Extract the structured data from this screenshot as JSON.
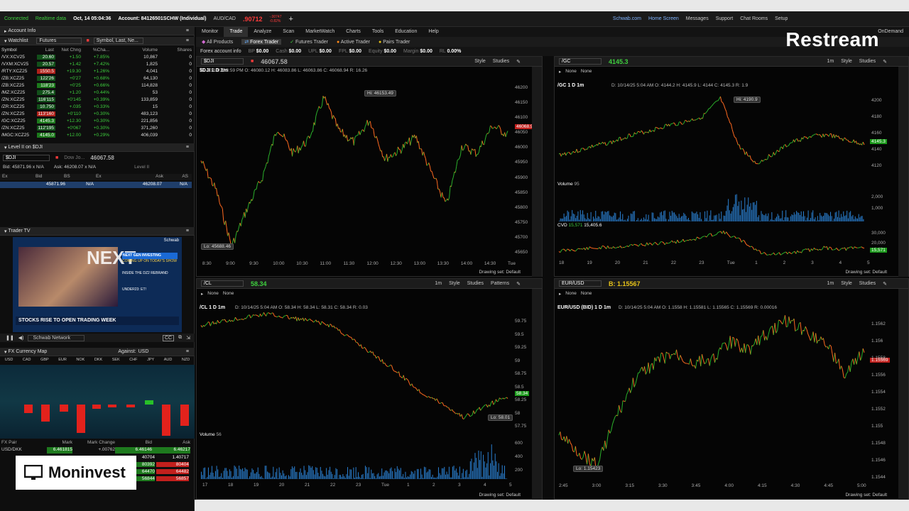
{
  "topbar": {
    "connected": "Connected",
    "realtime": "Realtime data",
    "datetime": "Oct, 14  05:04:36",
    "account": "Account: 84126501SCHW (Individual)",
    "pair": "AUD/CAD",
    "pair_value": ".90712",
    "pair_change": "-.00747",
    "pair_pct": "-0.82%",
    "schwab": "Schwab.com",
    "home": "Home Screen",
    "messages": "Messages",
    "support": "Support",
    "chat": "Chat Rooms",
    "setup": "Setup"
  },
  "menu": [
    "Monitor",
    "Trade",
    "Analyze",
    "Scan",
    "MarketWatch",
    "Charts",
    "Tools",
    "Education",
    "Help"
  ],
  "ondemand": "OnDemand",
  "subtabs": [
    "All Products",
    "Forex Trader",
    "Futures Trader",
    "Active Trader",
    "Pairs Trader"
  ],
  "acct": {
    "label": "Forex account info",
    "bp": "BP",
    "bp_v": "$0.00",
    "cash": "Cash",
    "cash_v": "$0.00",
    "upl": "UPL",
    "upl_v": "$0.00",
    "fpl": "FPL",
    "fpl_v": "$0.00",
    "equity": "Equity",
    "equity_v": "$0.00",
    "margin": "Margin",
    "margin_v": "$0.00",
    "rl": "RL",
    "rl_v": "0.00%"
  },
  "left": {
    "account_info": "Account Info",
    "watchlist": "Watchlist",
    "watchlist_type": "Futures",
    "symbol_search": "Symbol, Last, Ne...",
    "cols": [
      "Symbol",
      "Last",
      "Net Chng",
      "%Cha...",
      "Volume",
      "Shares"
    ],
    "rows": [
      {
        "sym": "/VX:XCV25",
        "last": "20.60",
        "net": "+1.50",
        "pct": "+7.85%",
        "vol": "10,867",
        "sh": "0",
        "up": true
      },
      {
        "sym": "/VXM:XCV25",
        "last": "20.57",
        "net": "+1.42",
        "pct": "+7.42%",
        "vol": "1,825",
        "sh": "0",
        "up": true
      },
      {
        "sym": "/RTY:XCZ25",
        "last": "1550.5",
        "net": "+19.30",
        "pct": "+1.26%",
        "vol": "4,041",
        "sh": "0",
        "up": true
      },
      {
        "sym": "/ZB:XCZ25",
        "last": "122'26",
        "net": "+0'27",
        "pct": "+0.68%",
        "vol": "64,130",
        "sh": "0",
        "up": true
      },
      {
        "sym": "/ZB:XCZ25",
        "last": "118'23",
        "net": "+0'25",
        "pct": "+0.66%",
        "vol": "114,828",
        "sh": "0",
        "up": true
      },
      {
        "sym": "/MZ:XCZ25",
        "last": "275.4",
        "net": "+1.20",
        "pct": "+0.44%",
        "vol": "53",
        "sh": "0",
        "up": true
      },
      {
        "sym": "/ZN:XCZ25",
        "last": "116'115",
        "net": "+0'145",
        "pct": "+0.39%",
        "vol": "133,859",
        "sh": "0",
        "up": true
      },
      {
        "sym": "/ZR:XCZ25",
        "last": "10.750",
        "net": "+.035",
        "pct": "+0.33%",
        "vol": "15",
        "sh": "0",
        "up": true
      },
      {
        "sym": "/ZN:XCZ25",
        "last": "113'160",
        "net": "+0'110",
        "pct": "+0.30%",
        "vol": "483,123",
        "sh": "0",
        "up": true
      },
      {
        "sym": "/GC:XCZ25",
        "last": "4145.3",
        "net": "+12.30",
        "pct": "+0.30%",
        "vol": "221,856",
        "sh": "0",
        "up": true
      },
      {
        "sym": "/ZN:XCZ25",
        "last": "112'195",
        "net": "+0'067",
        "pct": "+0.30%",
        "vol": "371,260",
        "sh": "0",
        "up": true
      },
      {
        "sym": "/MGC:XCZ25",
        "last": "4145.0",
        "net": "+12.00",
        "pct": "+0.29%",
        "vol": "406,039",
        "sh": "0",
        "up": true
      }
    ],
    "level2": "Level II on $DJI",
    "l2_sym": "$DJI",
    "l2_name": "Dow Jo...",
    "l2_price": "46067.58",
    "l2_bid": "Bid: 45871.96 x N/A",
    "l2_ask": "Ask: 46208.07 x N/A",
    "l2_label": "Level II",
    "l2_cols": [
      "Ex",
      "Bid",
      "BS",
      "Ex",
      "Ask",
      "AS"
    ],
    "l2_row": {
      "bid": "45871.96",
      "bs": "N/A",
      "ask": "46208.07",
      "as": "N/A"
    },
    "trader_tv": "Trader TV",
    "tv_brand": "Schwab",
    "tv_next": "NEXT",
    "tv_headline1": "NEXT GEN INVESTING",
    "tv_headline2": "COMING UP ON TODAY'S SHOW",
    "tv_line3": "INSIDE THE DZ2 REBRAND",
    "tv_line4": "UNDER23: ET!",
    "tv_ticker": "STOCKS RISE TO OPEN TRADING WEEK",
    "tv_network": "Schwab Network",
    "tv_cc": "CC",
    "fx_map": "FX Currency Map",
    "against": "Against:",
    "against_val": "USD",
    "fx_codes": [
      "USD",
      "CAD",
      "GBP",
      "EUR",
      "NOK",
      "DKK",
      "SEK",
      "CHF",
      "JPY",
      "AUD",
      "NZD"
    ],
    "fx_cols": [
      "FX Pair",
      "Mark",
      "Mark Change",
      "Bid",
      "Ask"
    ],
    "fx_row1": {
      "pair": "USD/DKK",
      "mark": "6.461815",
      "chg": "+.00762",
      "bid": "6.46146",
      "ask": "6.46217"
    },
    "fx_row_bids": [
      "40704",
      "80392",
      "64470",
      "56844"
    ],
    "fx_row_asks": [
      "1.40717",
      "80404",
      "64482",
      "56857"
    ]
  },
  "charts": {
    "dji": {
      "sym": "$DJI",
      "price": "46067.58",
      "title": "$DJI 1 D 1m",
      "info": "D: 10/13/25 3:59 PM   O: 46080.12   H: 46083.86   L: 46063.86   C: 46068.94   R: 16.26",
      "hi": "Hi: 46153.49",
      "lo": "Lo: 45688.46",
      "last": "46068.94",
      "y": [
        "46200",
        "46150",
        "46100",
        "46050",
        "46000",
        "45950",
        "45900",
        "45850",
        "45800",
        "45750",
        "45700",
        "45650"
      ],
      "x": [
        "8:30",
        "9:00",
        "9:30",
        "10:00",
        "10:30",
        "11:00",
        "11:30",
        "12:00",
        "12:30",
        "13:00",
        "13:30",
        "14:00",
        "14:30",
        "Tue"
      ],
      "drawing": "Drawing set: Default"
    },
    "gc": {
      "sym": "/GC",
      "price": "4145.3",
      "title": "/GC 1 D 1m",
      "info": "D: 10/14/25 5:04 AM   O: 4144.2   H: 4145.9   L: 4144   C: 4145.3   R: 1.9",
      "hi": "Hi: 4190.9",
      "last": "4145.3",
      "y": [
        "4200",
        "4180",
        "4160",
        "4140",
        "4120"
      ],
      "vol_label": "Volume",
      "vol_val": "95",
      "vol_y": [
        "2,000",
        "1,000"
      ],
      "cvd_label": "CVD",
      "cvd_v1": "15,571",
      "cvd_v2": "15,405.6",
      "cvd_y": [
        "30,000",
        "20,000"
      ],
      "cvd_last": "15,571",
      "x": [
        "18",
        "19",
        "20",
        "21",
        "22",
        "23",
        "Tue",
        "1",
        "2",
        "3",
        "4",
        "5"
      ],
      "drawing": "Drawing set: Default"
    },
    "cl": {
      "sym": "/CL",
      "price": "58.34",
      "title": "/CL 1 D 1m",
      "info": "D: 10/14/25 5:04 AM   O: 58.34   H: 58.34   L: 58.31   C: 58.34   R: 0.03",
      "lo": "Lo: 58.01",
      "last": "58.34",
      "y": [
        "59.75",
        "59.5",
        "59.25",
        "59",
        "58.75",
        "58.5",
        "58.25",
        "58",
        "57.75"
      ],
      "vol_label": "Volume",
      "vol_val": "56",
      "vol_y": [
        "600",
        "400",
        "200"
      ],
      "x": [
        "17",
        "18",
        "19",
        "20",
        "21",
        "22",
        "23",
        "Tue",
        "1",
        "2",
        "3",
        "4",
        "5"
      ],
      "drawing": "Drawing set: Default"
    },
    "eur": {
      "sym": "EUR/USD",
      "price": "B: 1.15567",
      "title": "EUR/USD (BID) 1 D 1m",
      "info": "D: 10/14/25 5:04 AM   O: 1.1558   H: 1.15581   L: 1.15565   C: 1.15569   R: 0.00016",
      "lo": "Lo: 1.15423",
      "last": "1.15569",
      "y": [
        "1.1562",
        "1.156",
        "1.1558",
        "1.1556",
        "1.1554",
        "1.1552",
        "1.155",
        "1.1548",
        "1.1546",
        "1.1544"
      ],
      "x": [
        "2:45",
        "3:00",
        "3:15",
        "3:30",
        "3:45",
        "4:00",
        "4:15",
        "4:30",
        "4:45",
        "5:00"
      ],
      "drawing": "Drawing set: Default"
    }
  },
  "toolbar": {
    "style": "Style",
    "studies": "Studies",
    "patterns": "Patterns",
    "tf": "1m",
    "none": "None"
  },
  "overlay": {
    "restream": "Restream",
    "moninvest": "Moninvest"
  }
}
